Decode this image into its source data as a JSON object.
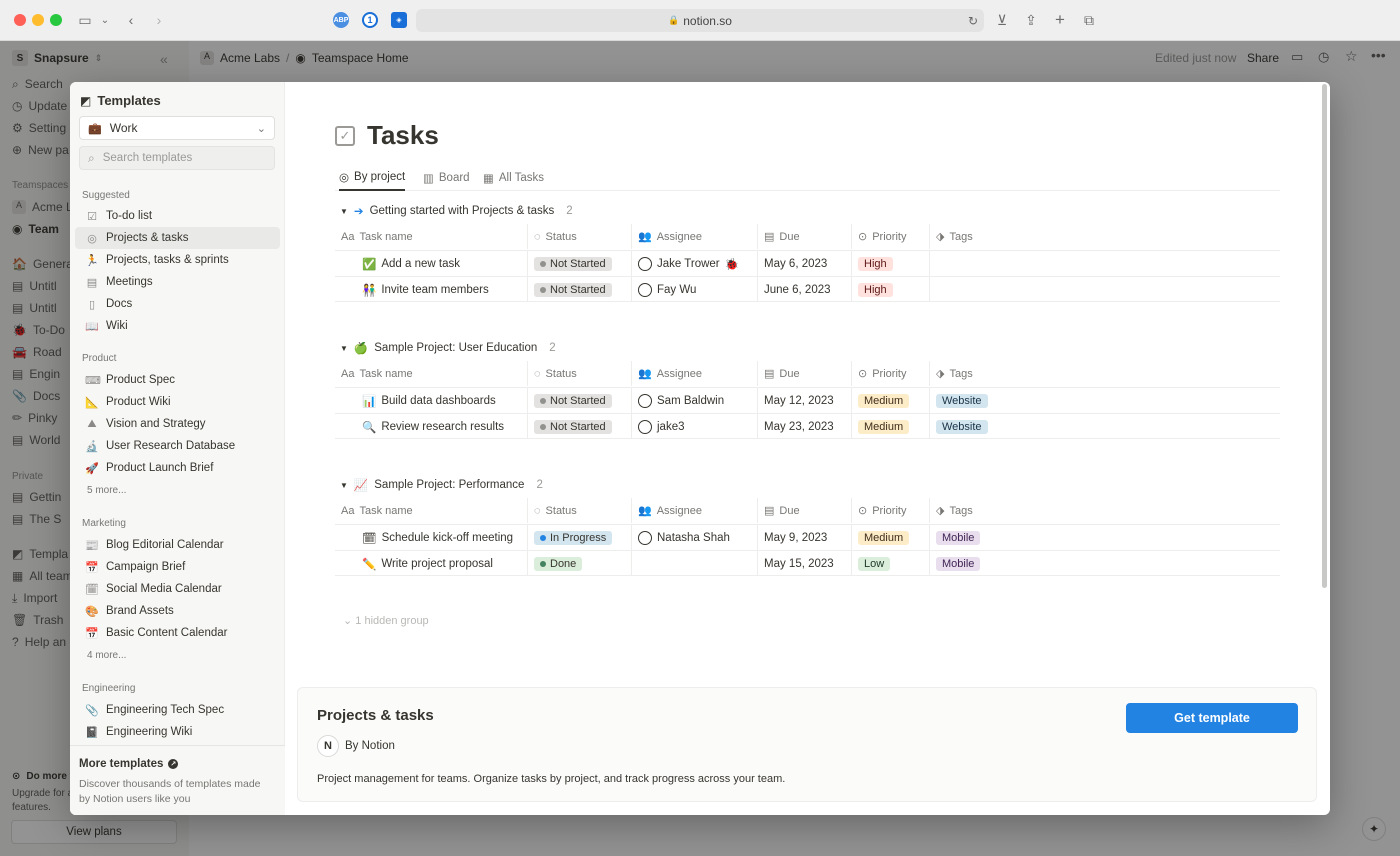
{
  "browser": {
    "url": "notion.so"
  },
  "app": {
    "workspace": "Snapsure",
    "breadcrumb": [
      "Acme Labs",
      "Teamspace Home"
    ],
    "breadcrumb_sep": "/",
    "edited": "Edited just now",
    "share": "Share",
    "sidebar_items": [
      "Search",
      "Update",
      "Setting",
      "New pa"
    ],
    "teamspaces_label": "Teamspaces",
    "teamspaces": [
      "Acme L",
      "Team"
    ],
    "pages": [
      "Genera",
      "Untitl",
      "Untitl",
      "To-Do",
      "Road",
      "Engin",
      "Docs",
      "Pinky",
      "World"
    ],
    "private_label": "Private",
    "private_pages": [
      "Gettin",
      "The S"
    ],
    "bottom_items": [
      "Templa",
      "All team",
      "Import",
      "Trash",
      "Help an"
    ],
    "do_more": "Do more w",
    "upgrade": "Upgrade for a",
    "features": "features.",
    "view_plans": "View plans"
  },
  "templates": {
    "title": "Templates",
    "category": "Work",
    "search_placeholder": "Search templates",
    "suggested_label": "Suggested",
    "suggested": [
      "To-do list",
      "Projects & tasks",
      "Projects, tasks & sprints",
      "Meetings",
      "Docs",
      "Wiki"
    ],
    "product_label": "Product",
    "product": [
      "Product Spec",
      "Product Wiki",
      "Vision and Strategy",
      "User Research Database",
      "Product Launch Brief"
    ],
    "product_more": "5 more...",
    "marketing_label": "Marketing",
    "marketing": [
      "Blog Editorial Calendar",
      "Campaign Brief",
      "Social Media Calendar",
      "Brand Assets",
      "Basic Content Calendar"
    ],
    "marketing_more": "4 more...",
    "engineering_label": "Engineering",
    "engineering": [
      "Engineering Tech Spec",
      "Engineering Wiki"
    ],
    "more_templates": "More templates",
    "more_desc_1": "Discover thousands of templates made",
    "more_desc_2": "by Notion users like you"
  },
  "preview": {
    "page_title": "Tasks",
    "tabs": [
      "By project",
      "Board",
      "All Tasks"
    ],
    "columns": [
      "Task name",
      "Status",
      "Assignee",
      "Due",
      "Priority",
      "Tags"
    ],
    "columns_prefix": "Aa",
    "groups": [
      {
        "name": "Getting started with Projects & tasks",
        "count": "2",
        "rows": [
          {
            "task": "Add a new task",
            "status": "Not Started",
            "assignee": "Jake Trower",
            "due": "May 6, 2023",
            "priority": "High",
            "tag": ""
          },
          {
            "task": "Invite team members",
            "status": "Not Started",
            "assignee": "Fay Wu",
            "due": "June 6, 2023",
            "priority": "High",
            "tag": ""
          }
        ]
      },
      {
        "name": "Sample Project: User Education",
        "count": "2",
        "rows": [
          {
            "task": "Build data dashboards",
            "status": "Not Started",
            "assignee": "Sam Baldwin",
            "due": "May 12, 2023",
            "priority": "Medium",
            "tag": "Website"
          },
          {
            "task": "Review research results",
            "status": "Not Started",
            "assignee": "jake3",
            "due": "May 23, 2023",
            "priority": "Medium",
            "tag": "Website"
          }
        ]
      },
      {
        "name": "Sample Project: Performance",
        "count": "2",
        "rows": [
          {
            "task": "Schedule kick-off meeting",
            "status": "In Progress",
            "assignee": "Natasha Shah",
            "due": "May 9, 2023",
            "priority": "Medium",
            "tag": "Mobile"
          },
          {
            "task": "Write project proposal",
            "status": "Done",
            "assignee": "",
            "due": "May 15, 2023",
            "priority": "Low",
            "tag": "Mobile"
          }
        ]
      }
    ],
    "hidden_group": "1 hidden group"
  },
  "info": {
    "title": "Projects & tasks",
    "by": "By Notion",
    "description": "Project management for teams. Organize tasks by project, and track progress across your team.",
    "cta": "Get template"
  },
  "colors": {
    "accent": "#2383e2",
    "high": "#ffe2dd",
    "medium": "#fdecc8",
    "low": "#dbeddb",
    "website": "#d3e5ef",
    "mobile": "#e8deee",
    "not_started": "#e3e2e0",
    "in_progress": "#d3e5ef",
    "done": "#dbeddb"
  }
}
